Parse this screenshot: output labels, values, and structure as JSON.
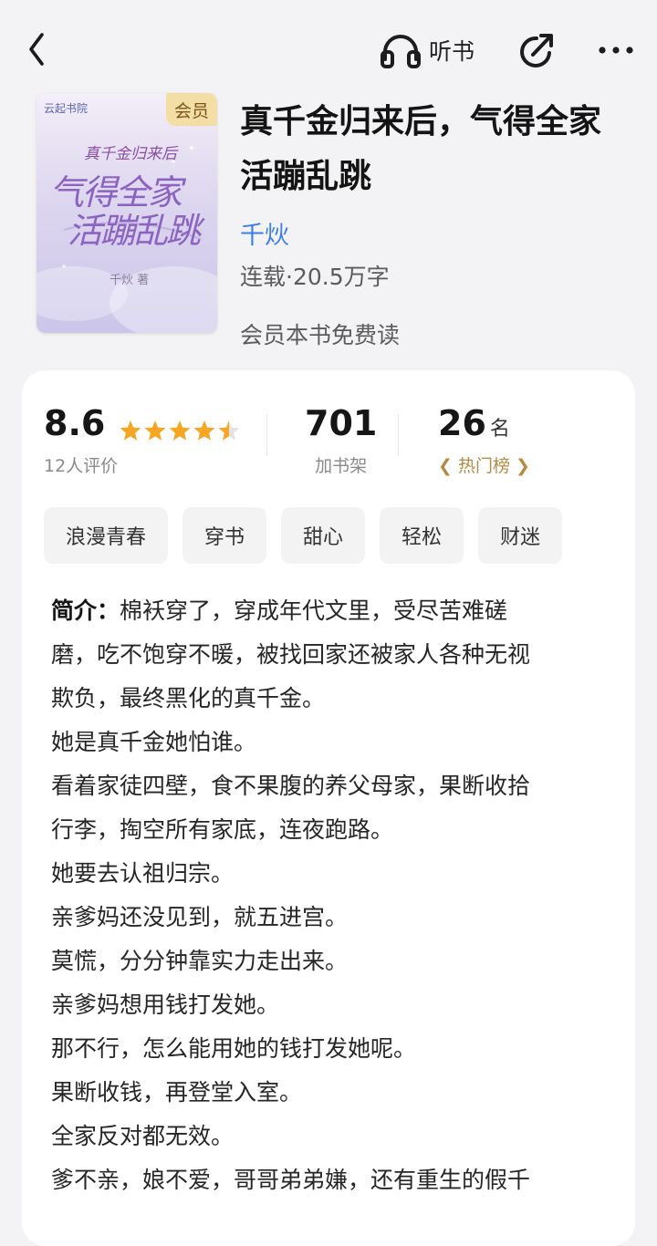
{
  "header": {
    "listen_label": "听书",
    "icons": [
      "back-icon",
      "headphones-icon",
      "share-icon",
      "more-icon"
    ]
  },
  "book": {
    "title": "真千金归来后，气得全家活蹦乱跳",
    "author": "千炏",
    "meta": "连载·20.5万字",
    "vip_note": "会员本书免费读",
    "cover": {
      "badge": "会员",
      "publisher": "云起书院",
      "subtitle": "真千金归来后",
      "title_line1": "气得全家",
      "title_line2": "活蹦乱跳",
      "author_sig": "千炏 著"
    }
  },
  "stats": {
    "rating": {
      "value": "8.6",
      "caption": "12人评价",
      "stars": 4.5
    },
    "shelf": {
      "value": "701",
      "caption": "加书架"
    },
    "rank": {
      "value": "26",
      "unit": "名",
      "caption": "热门榜"
    }
  },
  "tags": [
    "浪漫青春",
    "穿书",
    "甜心",
    "轻松",
    "财迷"
  ],
  "intro": {
    "label": "简介：",
    "lines": [
      "棉袄穿了，穿成年代文里，受尽苦难磋",
      "磨，吃不饱穿不暖，被找回家还被家人各种无视",
      "欺负，最终黑化的真千金。",
      "她是真千金她怕谁。",
      "看着家徒四壁，食不果腹的养父母家，果断收拾",
      "行李，掏空所有家底，连夜跑路。",
      "她要去认祖归宗。",
      "亲爹妈还没见到，就五进宫。",
      "莫慌，分分钟靠实力走出来。",
      "亲爹妈想用钱打发她。",
      "那不行，怎么能用她的钱打发她呢。",
      "果断收钱，再登堂入室。",
      "全家反对都无效。",
      "爹不亲，娘不爱，哥哥弟弟嫌，还有重生的假千"
    ]
  },
  "colors": {
    "author_link": "#3a7df0",
    "star": "#f5a623",
    "rank_gold": "#b58a45",
    "vip_badge": "#f3dfa6"
  }
}
